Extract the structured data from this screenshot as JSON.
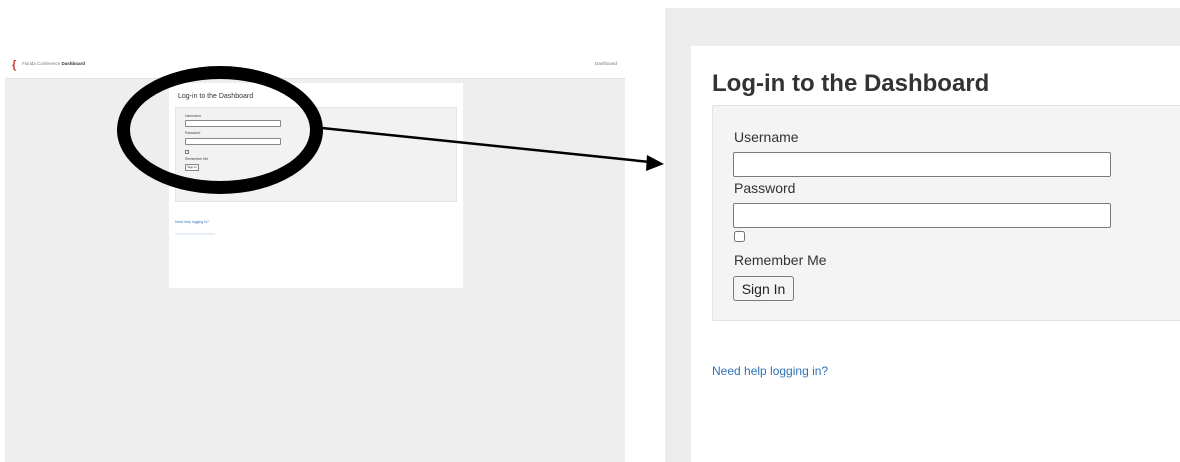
{
  "mini_page": {
    "brand_prefix": "Florida Conference",
    "brand_bold": "Dashboard",
    "nav_link": "Dashboard",
    "form_title": "Log-in to the Dashboard",
    "username_label": "Username",
    "password_label": "Password",
    "remember_label": "Remember Me",
    "signin_label": "Sign In",
    "help_link": "Need help logging in?"
  },
  "login": {
    "title": "Log-in to the Dashboard",
    "username_label": "Username",
    "username_value": "",
    "password_label": "Password",
    "password_value": "",
    "remember_label": "Remember Me",
    "remember_checked": false,
    "signin_label": "Sign In",
    "help_link": "Need help logging in?"
  },
  "colors": {
    "link": "#2f72b8",
    "logo_accent": "#c0392b",
    "highlight": "#000000"
  },
  "icons": {
    "logo": "flame-cross-icon"
  }
}
